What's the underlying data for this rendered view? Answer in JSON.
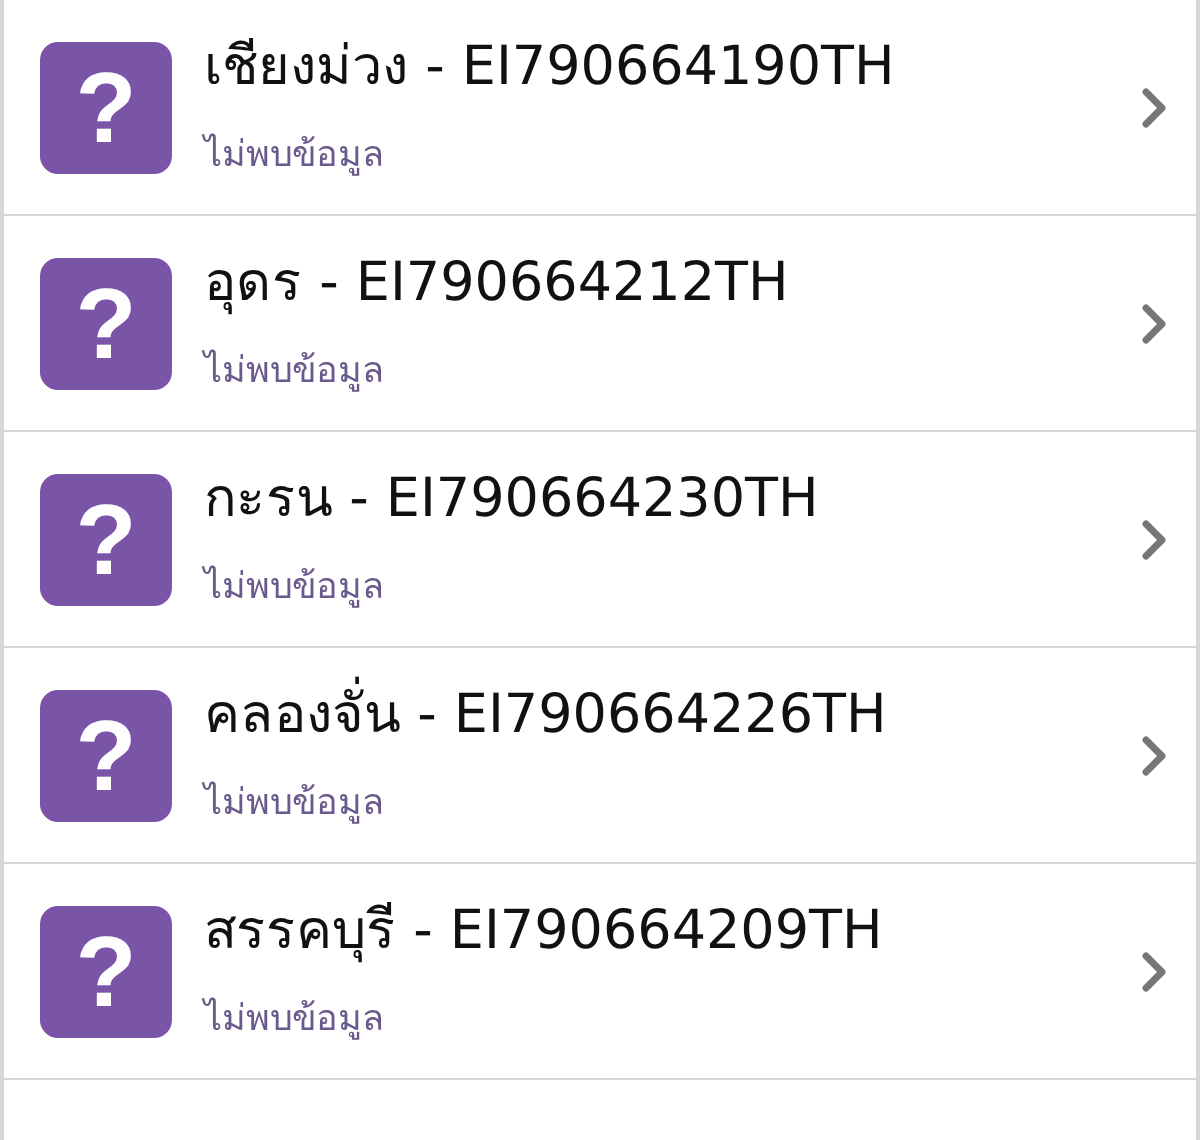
{
  "items": [
    {
      "icon": "?",
      "title": "เชียงม่วง - EI790664190TH",
      "subtitle": "ไม่พบข้อมูล"
    },
    {
      "icon": "?",
      "title": "อุดร - EI790664212TH",
      "subtitle": "ไม่พบข้อมูล"
    },
    {
      "icon": "?",
      "title": "กะรน - EI790664230TH",
      "subtitle": "ไม่พบข้อมูล"
    },
    {
      "icon": "?",
      "title": "คลองจั่น - EI790664226TH",
      "subtitle": "ไม่พบข้อมูล"
    },
    {
      "icon": "?",
      "title": "สรรคบุรี - EI790664209TH",
      "subtitle": "ไม่พบข้อมูล"
    }
  ]
}
